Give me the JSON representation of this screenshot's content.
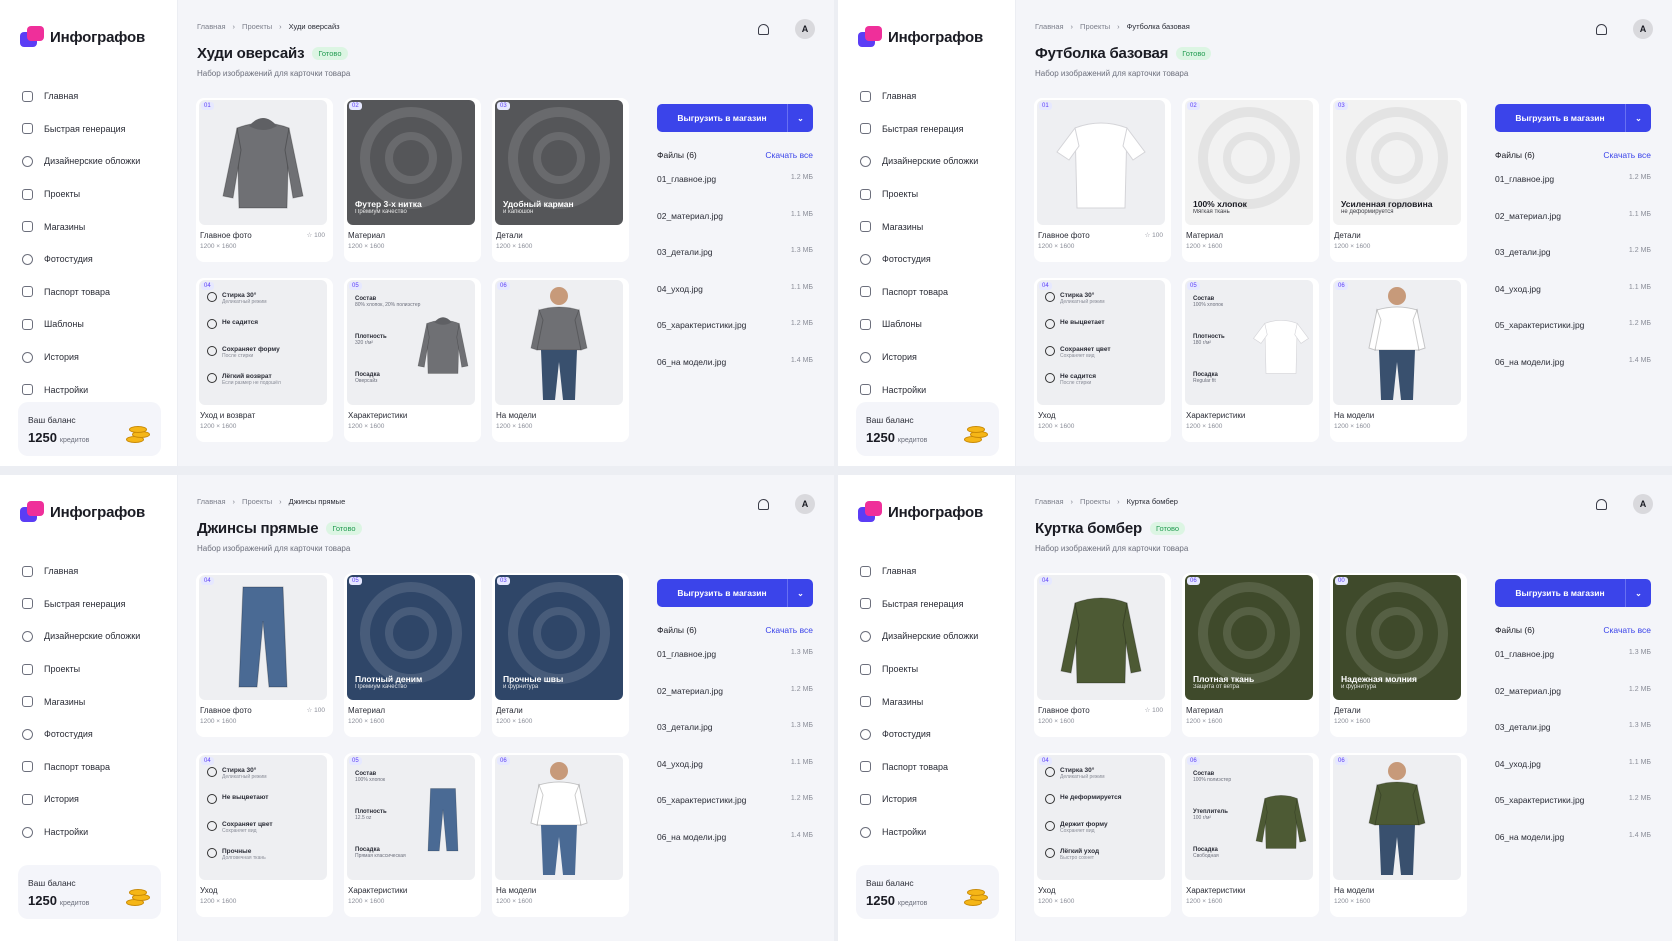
{
  "panels": [
    {
      "logo": "Инфографов",
      "nav": [
        {
          "label": "Главная",
          "icon": "home-icon"
        },
        {
          "label": "Быстрая генерация",
          "icon": "magic-wand-icon"
        },
        {
          "label": "Дизайнерские обложки",
          "icon": "edit-icon"
        },
        {
          "label": "Проекты",
          "icon": "folder-icon"
        },
        {
          "label": "Магазины",
          "icon": "store-icon"
        },
        {
          "label": "Фотостудия",
          "icon": "camera-icon"
        },
        {
          "label": "Паспорт товара",
          "icon": "passport-icon"
        },
        {
          "label": "Шаблоны",
          "icon": "template-icon"
        },
        {
          "label": "История",
          "icon": "history-icon"
        },
        {
          "label": "Настройки",
          "icon": "gear-icon"
        }
      ],
      "balance": {
        "label": "Ваш баланс",
        "amount": "1250",
        "unit": "кредитов"
      },
      "breadcrumb": [
        "Главная",
        "Проекты",
        "Худи оверсайз"
      ],
      "title": "Худи оверсайз",
      "status": "Готово",
      "subtitle": "Набор изображений для карточки товара",
      "avatar": "A",
      "export_label": "Выгрузить в магазин",
      "files_title": "Файлы (6)",
      "download_all": "Скачать все",
      "files": [
        {
          "name": "01_главное.jpg",
          "size": "1.2 МБ"
        },
        {
          "name": "02_материал.jpg",
          "size": "1.1 МБ"
        },
        {
          "name": "03_детали.jpg",
          "size": "1.3 МБ"
        },
        {
          "name": "04_уход.jpg",
          "size": "1.1 МБ"
        },
        {
          "name": "05_характеристики.jpg",
          "size": "1.2 МБ"
        },
        {
          "name": "06_на модели.jpg",
          "size": "1.4 МБ"
        }
      ],
      "cards": [
        {
          "num": "01",
          "title": "Главное фото",
          "size": "1200 × 1600",
          "note": "☆ 100",
          "kind": "product"
        },
        {
          "num": "02",
          "title": "Материал",
          "size": "1200 × 1600",
          "caption": "Футер 3-х нитка",
          "caption_sub": "Премиум качество",
          "kind": "dark"
        },
        {
          "num": "03",
          "title": "Детали",
          "size": "1200 × 1600",
          "caption": "Удобный карман",
          "caption_sub": "и капюшон",
          "kind": "dark"
        },
        {
          "num": "04",
          "title": "Уход и возврат",
          "size": "1200 × 1600",
          "kind": "care",
          "features": [
            {
              "t": "Стирка 30°",
              "s": "Деликатный режим"
            },
            {
              "t": "Не садится",
              "s": ""
            },
            {
              "t": "Сохраняет форму",
              "s": "После стирки"
            },
            {
              "t": "Лёгкий возврат",
              "s": "Если размер не подошёл"
            }
          ]
        },
        {
          "num": "05",
          "title": "Характеристики",
          "size": "1200 × 1600",
          "kind": "spec",
          "specs": [
            {
              "t": "Состав",
              "s": "80% хлопок, 20% полиэстер"
            },
            {
              "t": "Плотность",
              "s": "320 г/м²"
            },
            {
              "t": "Посадка",
              "s": "Оверсайз"
            }
          ]
        },
        {
          "num": "06",
          "title": "На модели",
          "size": "1200 × 1600",
          "kind": "model"
        }
      ]
    },
    {
      "logo": "Инфографов",
      "nav": [
        {
          "label": "Главная",
          "icon": "home-icon"
        },
        {
          "label": "Быстрая генерация",
          "icon": "magic-wand-icon"
        },
        {
          "label": "Дизайнерские обложки",
          "icon": "edit-icon"
        },
        {
          "label": "Проекты",
          "icon": "folder-icon"
        },
        {
          "label": "Магазины",
          "icon": "store-icon"
        },
        {
          "label": "Фотостудия",
          "icon": "camera-icon"
        },
        {
          "label": "Паспорт товара",
          "icon": "passport-icon"
        },
        {
          "label": "Шаблоны",
          "icon": "template-icon"
        },
        {
          "label": "История",
          "icon": "history-icon"
        },
        {
          "label": "Настройки",
          "icon": "gear-icon"
        }
      ],
      "balance": {
        "label": "Ваш баланс",
        "amount": "1250",
        "unit": "кредитов"
      },
      "breadcrumb": [
        "Главная",
        "Проекты",
        "Футболка базовая"
      ],
      "title": "Футболка базовая",
      "status": "Готово",
      "subtitle": "Набор изображений для карточки товара",
      "avatar": "A",
      "export_label": "Выгрузить в магазин",
      "files_title": "Файлы (6)",
      "download_all": "Скачать все",
      "files": [
        {
          "name": "01_главное.jpg",
          "size": "1.2 МБ"
        },
        {
          "name": "02_материал.jpg",
          "size": "1.1 МБ"
        },
        {
          "name": "03_детали.jpg",
          "size": "1.2 МБ"
        },
        {
          "name": "04_уход.jpg",
          "size": "1.1 МБ"
        },
        {
          "name": "05_характеристики.jpg",
          "size": "1.2 МБ"
        },
        {
          "name": "06_на модели.jpg",
          "size": "1.4 МБ"
        }
      ],
      "cards": [
        {
          "num": "01",
          "title": "Главное фото",
          "size": "1200 × 1600",
          "note": "☆ 100",
          "kind": "product"
        },
        {
          "num": "02",
          "title": "Материал",
          "size": "1200 × 1600",
          "caption": "100% хлопок",
          "caption_sub": "Мягкая ткань",
          "kind": "light"
        },
        {
          "num": "03",
          "title": "Детали",
          "size": "1200 × 1600",
          "caption": "Усиленная горловина",
          "caption_sub": "не деформируется",
          "kind": "light"
        },
        {
          "num": "04",
          "title": "Уход",
          "size": "1200 × 1600",
          "kind": "care",
          "features": [
            {
              "t": "Стирка 30°",
              "s": "Деликатный режим"
            },
            {
              "t": "Не выцветает",
              "s": ""
            },
            {
              "t": "Сохраняет цвет",
              "s": "Сохраняет вид"
            },
            {
              "t": "Не садится",
              "s": "После стирки"
            }
          ]
        },
        {
          "num": "05",
          "title": "Характеристики",
          "size": "1200 × 1600",
          "kind": "spec",
          "specs": [
            {
              "t": "Состав",
              "s": "100% хлопок"
            },
            {
              "t": "Плотность",
              "s": "180 г/м²"
            },
            {
              "t": "Посадка",
              "s": "Regular fit"
            }
          ]
        },
        {
          "num": "06",
          "title": "На модели",
          "size": "1200 × 1600",
          "kind": "model"
        }
      ]
    },
    {
      "logo": "Инфографов",
      "nav": [
        {
          "label": "Главная",
          "icon": "home-icon"
        },
        {
          "label": "Быстрая генерация",
          "icon": "magic-wand-icon"
        },
        {
          "label": "Дизайнерские обложки",
          "icon": "edit-icon"
        },
        {
          "label": "Проекты",
          "icon": "folder-icon"
        },
        {
          "label": "Магазины",
          "icon": "store-icon"
        },
        {
          "label": "Фотостудия",
          "icon": "camera-icon"
        },
        {
          "label": "Паспорт товара",
          "icon": "passport-icon"
        },
        {
          "label": "История",
          "icon": "history-icon"
        },
        {
          "label": "Настройки",
          "icon": "gear-icon"
        }
      ],
      "balance": {
        "label": "Ваш баланс",
        "amount": "1250",
        "unit": "кредитов"
      },
      "breadcrumb": [
        "Главная",
        "Проекты",
        "Джинсы прямые"
      ],
      "title": "Джинсы прямые",
      "status": "Готово",
      "subtitle": "Набор изображений для карточки товара",
      "avatar": "A",
      "export_label": "Выгрузить в магазин",
      "files_title": "Файлы (6)",
      "download_all": "Скачать все",
      "files": [
        {
          "name": "01_главное.jpg",
          "size": "1.3 МБ"
        },
        {
          "name": "02_материал.jpg",
          "size": "1.2 МБ"
        },
        {
          "name": "03_детали.jpg",
          "size": "1.3 МБ"
        },
        {
          "name": "04_уход.jpg",
          "size": "1.1 МБ"
        },
        {
          "name": "05_характеристики.jpg",
          "size": "1.2 МБ"
        },
        {
          "name": "06_на модели.jpg",
          "size": "1.4 МБ"
        }
      ],
      "cards": [
        {
          "num": "04",
          "title": "Главное фото",
          "size": "1200 × 1600",
          "note": "☆ 100",
          "kind": "product"
        },
        {
          "num": "05",
          "title": "Материал",
          "size": "1200 × 1600",
          "caption": "Плотный деним",
          "caption_sub": "Премиум качество",
          "kind": "denim"
        },
        {
          "num": "03",
          "title": "Детали",
          "size": "1200 × 1600",
          "caption": "Прочные швы",
          "caption_sub": "и фурнитура",
          "kind": "denim"
        },
        {
          "num": "04",
          "title": "Уход",
          "size": "1200 × 1600",
          "kind": "care",
          "features": [
            {
              "t": "Стирка 30°",
              "s": "Деликатный режим"
            },
            {
              "t": "Не выцветают",
              "s": ""
            },
            {
              "t": "Сохраняет цвет",
              "s": "Сохраняет вид"
            },
            {
              "t": "Прочные",
              "s": "Долговечная ткань"
            }
          ]
        },
        {
          "num": "05",
          "title": "Характеристики",
          "size": "1200 × 1600",
          "kind": "spec",
          "specs": [
            {
              "t": "Состав",
              "s": "100% хлопок"
            },
            {
              "t": "Плотность",
              "s": "12.5 oz"
            },
            {
              "t": "Посадка",
              "s": "Прямая классическая"
            }
          ]
        },
        {
          "num": "06",
          "title": "На модели",
          "size": "1200 × 1600",
          "kind": "model"
        }
      ]
    },
    {
      "logo": "Инфографов",
      "nav": [
        {
          "label": "Главная",
          "icon": "home-icon"
        },
        {
          "label": "Быстрая генерация",
          "icon": "magic-wand-icon"
        },
        {
          "label": "Дизайнерские обложки",
          "icon": "edit-icon"
        },
        {
          "label": "Проекты",
          "icon": "folder-icon"
        },
        {
          "label": "Магазины",
          "icon": "store-icon"
        },
        {
          "label": "Фотостудия",
          "icon": "camera-icon"
        },
        {
          "label": "Паспорт товара",
          "icon": "passport-icon"
        },
        {
          "label": "История",
          "icon": "history-icon"
        },
        {
          "label": "Настройки",
          "icon": "gear-icon"
        }
      ],
      "balance": {
        "label": "Ваш баланс",
        "amount": "1250",
        "unit": "кредитов"
      },
      "breadcrumb": [
        "Главная",
        "Проекты",
        "Куртка бомбер"
      ],
      "title": "Куртка бомбер",
      "status": "Готово",
      "subtitle": "Набор изображений для карточки товара",
      "avatar": "A",
      "export_label": "Выгрузить в магазин",
      "files_title": "Файлы (6)",
      "download_all": "Скачать все",
      "files": [
        {
          "name": "01_главное.jpg",
          "size": "1.3 МБ"
        },
        {
          "name": "02_материал.jpg",
          "size": "1.2 МБ"
        },
        {
          "name": "03_детали.jpg",
          "size": "1.3 МБ"
        },
        {
          "name": "04_уход.jpg",
          "size": "1.1 МБ"
        },
        {
          "name": "05_характеристики.jpg",
          "size": "1.2 МБ"
        },
        {
          "name": "06_на модели.jpg",
          "size": "1.4 МБ"
        }
      ],
      "cards": [
        {
          "num": "04",
          "title": "Главное фото",
          "size": "1200 × 1600",
          "note": "☆ 100",
          "kind": "product"
        },
        {
          "num": "06",
          "title": "Материал",
          "size": "1200 × 1600",
          "caption": "Плотная ткань",
          "caption_sub": "Защита от ветра",
          "kind": "olive"
        },
        {
          "num": "00",
          "title": "Детали",
          "size": "1200 × 1600",
          "caption": "Надежная молния",
          "caption_sub": "и фурнитура",
          "kind": "olive"
        },
        {
          "num": "04",
          "title": "Уход",
          "size": "1200 × 1600",
          "kind": "care",
          "features": [
            {
              "t": "Стирка 30°",
              "s": "Деликатный режим"
            },
            {
              "t": "Не деформируется",
              "s": ""
            },
            {
              "t": "Держит форму",
              "s": "Сохраняет вид"
            },
            {
              "t": "Лёгкий уход",
              "s": "Быстро сохнет"
            }
          ]
        },
        {
          "num": "06",
          "title": "Характеристики",
          "size": "1200 × 1600",
          "kind": "spec",
          "specs": [
            {
              "t": "Состав",
              "s": "100% полиэстер"
            },
            {
              "t": "Утеплитель",
              "s": "100 г/м²"
            },
            {
              "t": "Посадка",
              "s": "Свободная"
            }
          ]
        },
        {
          "num": "06",
          "title": "На модели",
          "size": "1200 × 1600",
          "kind": "model"
        }
      ]
    }
  ],
  "colors": {
    "accent": "#3b44ea",
    "logo_purple": "#5b3df5",
    "logo_pink": "#ef2f9a",
    "status_green": "#239c52",
    "hoodie": "#6f7074",
    "tee": "#ffffff",
    "jeans": "#4a6a94",
    "jacket": "#4d5a34"
  }
}
